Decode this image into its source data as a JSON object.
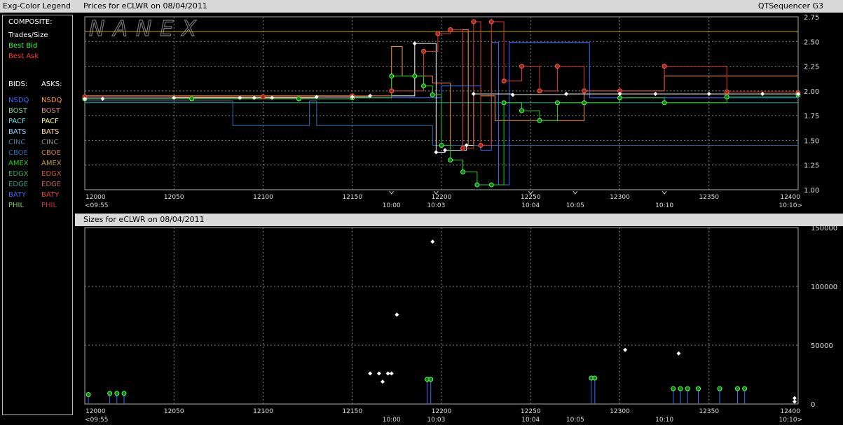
{
  "legend": {
    "title": "Exg-Color Legend",
    "composite_label": "COMPOSITE:",
    "composite": [
      {
        "label": "Trades/Size",
        "color": "#ffffff"
      },
      {
        "label": "Best Bid",
        "color": "#33ff33"
      },
      {
        "label": "Best Ask",
        "color": "#ff3333"
      }
    ],
    "bids_label": "BIDS:",
    "asks_label": "ASKS:",
    "exchanges": [
      {
        "bid": "NSDQ",
        "ask": "NSDQ",
        "bid_color": "#3a6cff",
        "ask_color": "#ff9a3a"
      },
      {
        "bid": "BOST",
        "ask": "BOST",
        "bid_color": "#8fd18f",
        "ask_color": "#d88a8a"
      },
      {
        "bid": "PACF",
        "ask": "PACF",
        "bid_color": "#5fe0e0",
        "ask_color": "#ffff66"
      },
      {
        "bid": "BATS",
        "ask": "BATS",
        "bid_color": "#9fd0ff",
        "ask_color": "#ffe0a0"
      },
      {
        "bid": "CINC",
        "ask": "CINC",
        "bid_color": "#4a7a9a",
        "ask_color": "#8a8a8a"
      },
      {
        "bid": "CBOE",
        "ask": "CBOE",
        "bid_color": "#2a6fb0",
        "ask_color": "#d08030"
      },
      {
        "bid": "AMEX",
        "ask": "AMEX",
        "bid_color": "#22cc22",
        "ask_color": "#c0a030"
      },
      {
        "bid": "EDGX",
        "ask": "EDGX",
        "bid_color": "#33aa55",
        "ask_color": "#d05030"
      },
      {
        "bid": "EDGE",
        "ask": "EDGE",
        "bid_color": "#2aa088",
        "ask_color": "#c06060"
      },
      {
        "bid": "BATY",
        "ask": "BATY",
        "bid_color": "#4466ee",
        "ask_color": "#e04040"
      },
      {
        "bid": "PHIL",
        "ask": "PHIL",
        "bid_color": "#88cc44",
        "ask_color": "#c03050"
      }
    ]
  },
  "header": {
    "prices_title": "Prices for  eCLWR  on  08/04/2011",
    "sizes_title": "Sizes for  eCLWR  on  08/04/2011",
    "app_name": "QTSequencer G3"
  },
  "watermark": "NANEX",
  "chart_data": [
    {
      "type": "line",
      "title": "Prices for  eCLWR  on  08/04/2011",
      "xlim": [
        12000,
        12400
      ],
      "ylim": [
        1.0,
        2.75
      ],
      "x_ticks": [
        12000,
        12050,
        12100,
        12150,
        12200,
        12250,
        12300,
        12350,
        12400
      ],
      "y_ticks": [
        1.0,
        1.25,
        1.5,
        1.75,
        2.0,
        2.25,
        2.5,
        2.75
      ],
      "y_tick_labels": [
        "1.00",
        "1.25",
        "1.50",
        "1.75",
        "2.00",
        "2.25",
        "2.50",
        "2.75"
      ],
      "time_labels": [
        {
          "x": 12000,
          "label": "<09:55"
        },
        {
          "x": 12172,
          "label": "10:00"
        },
        {
          "x": 12197,
          "label": "10:03"
        },
        {
          "x": 12250,
          "label": "10:04"
        },
        {
          "x": 12275,
          "label": "10:05"
        },
        {
          "x": 12325,
          "label": "10:10"
        },
        {
          "x": 12400,
          "label": "10:10>"
        }
      ],
      "grid": true,
      "series": [
        {
          "name": "Best Bid",
          "color": "#1fd11f",
          "x": [
            12000,
            12060,
            12120,
            12150,
            12172,
            12185,
            12190,
            12195,
            12200,
            12205,
            12212,
            12220,
            12228,
            12235,
            12245,
            12255,
            12265,
            12280,
            12300,
            12325,
            12360,
            12400
          ],
          "y": [
            1.92,
            1.92,
            1.92,
            1.93,
            2.15,
            2.15,
            2.05,
            1.96,
            1.45,
            1.3,
            1.18,
            1.05,
            1.05,
            1.88,
            1.8,
            1.7,
            1.88,
            1.88,
            1.93,
            1.88,
            1.94,
            1.96
          ]
        },
        {
          "name": "Best Ask",
          "color": "#e03a2a",
          "x": [
            12000,
            12100,
            12150,
            12172,
            12190,
            12198,
            12205,
            12212,
            12218,
            12222,
            12228,
            12235,
            12245,
            12255,
            12265,
            12280,
            12300,
            12325,
            12360,
            12400
          ],
          "y": [
            1.94,
            1.94,
            1.95,
            2.0,
            2.4,
            2.58,
            2.62,
            1.42,
            2.7,
            1.45,
            2.7,
            2.1,
            2.25,
            2.0,
            2.25,
            2.0,
            2.0,
            2.25,
            1.99,
            1.98
          ]
        },
        {
          "name": "Trades/Size",
          "color": "#ffffff",
          "x": [
            12000,
            12010,
            12050,
            12087,
            12095,
            12105,
            12130,
            12150,
            12160,
            12185,
            12197,
            12202,
            12214,
            12218,
            12240,
            12270,
            12300,
            12320,
            12350,
            12380,
            12400
          ],
          "y": [
            1.92,
            1.92,
            1.93,
            1.93,
            1.93,
            1.93,
            1.94,
            1.94,
            1.95,
            2.48,
            1.38,
            1.4,
            1.45,
            1.97,
            1.96,
            1.97,
            1.97,
            1.97,
            1.97,
            1.97,
            1.97
          ]
        },
        {
          "name": "NSDQ",
          "color": "#3a6cff",
          "x": [
            12000,
            12195,
            12200,
            12215,
            12222,
            12228,
            12232,
            12236,
            12238,
            12260,
            12280,
            12283,
            12400
          ],
          "y": [
            1.93,
            1.93,
            2.05,
            2.05,
            1.4,
            2.49,
            1.05,
            1.05,
            2.49,
            2.49,
            2.49,
            1.93,
            1.93
          ]
        },
        {
          "name": "CBOE",
          "color": "#2a6fb0",
          "x": [
            12000,
            12083,
            12083,
            12126,
            12126,
            12130,
            12130,
            12195,
            12195,
            12400
          ],
          "y": [
            1.9,
            1.9,
            1.65,
            1.65,
            1.9,
            1.9,
            1.65,
            1.65,
            1.45,
            1.45
          ]
        },
        {
          "name": "AMEX",
          "color": "#c0a030",
          "x": [
            12000,
            12080,
            12080,
            12192,
            12202,
            12202,
            12215,
            12215,
            12400
          ],
          "y": [
            2.6,
            2.6,
            2.6,
            2.6,
            2.6,
            2.6,
            2.6,
            2.6,
            2.6
          ]
        },
        {
          "name": "NSDQ ask",
          "color": "#ff9a3a",
          "x": [
            12000,
            12172,
            12172,
            12178,
            12185,
            12195,
            12205,
            12205,
            12212,
            12215,
            12222,
            12230,
            12230,
            12280,
            12280,
            12325,
            12325,
            12400
          ],
          "y": [
            1.95,
            1.95,
            2.45,
            2.15,
            2.15,
            2.08,
            2.0,
            1.45,
            2.62,
            1.45,
            1.95,
            1.7,
            1.7,
            1.7,
            2.0,
            2.0,
            2.15,
            2.15
          ]
        },
        {
          "name": "EDGE",
          "color": "#2aa088",
          "x": [
            12000,
            12400
          ],
          "y": [
            1.88,
            1.88
          ]
        }
      ]
    },
    {
      "type": "scatter",
      "title": "Sizes for  eCLWR  on  08/04/2011",
      "xlim": [
        12000,
        12400
      ],
      "ylim": [
        0,
        150000
      ],
      "x_ticks": [
        12000,
        12050,
        12100,
        12150,
        12200,
        12250,
        12300,
        12350,
        12400
      ],
      "y_ticks": [
        0,
        50000,
        100000,
        150000
      ],
      "y_tick_labels": [
        "0",
        "50000",
        "100000",
        "150000"
      ],
      "grid": true,
      "series": [
        {
          "name": "Trades/Size",
          "color": "#ffffff",
          "x": [
            12160,
            12165,
            12170,
            12167,
            12172,
            12175,
            12195,
            12303,
            12333,
            12398,
            12398
          ],
          "y": [
            26000,
            26000,
            26000,
            19000,
            26000,
            76000,
            138000,
            46000,
            43000,
            5000,
            2000
          ]
        },
        {
          "name": "Best Bid",
          "color": "#1fd11f",
          "x": [
            12002,
            12014,
            12018,
            12022,
            12192,
            12194,
            12284,
            12286,
            12330,
            12334,
            12338,
            12344,
            12356,
            12366,
            12370
          ],
          "y": [
            8000,
            9000,
            9000,
            9000,
            21000,
            21000,
            22000,
            22000,
            13000,
            13000,
            13000,
            13000,
            13000,
            13000,
            13000
          ]
        }
      ]
    }
  ]
}
